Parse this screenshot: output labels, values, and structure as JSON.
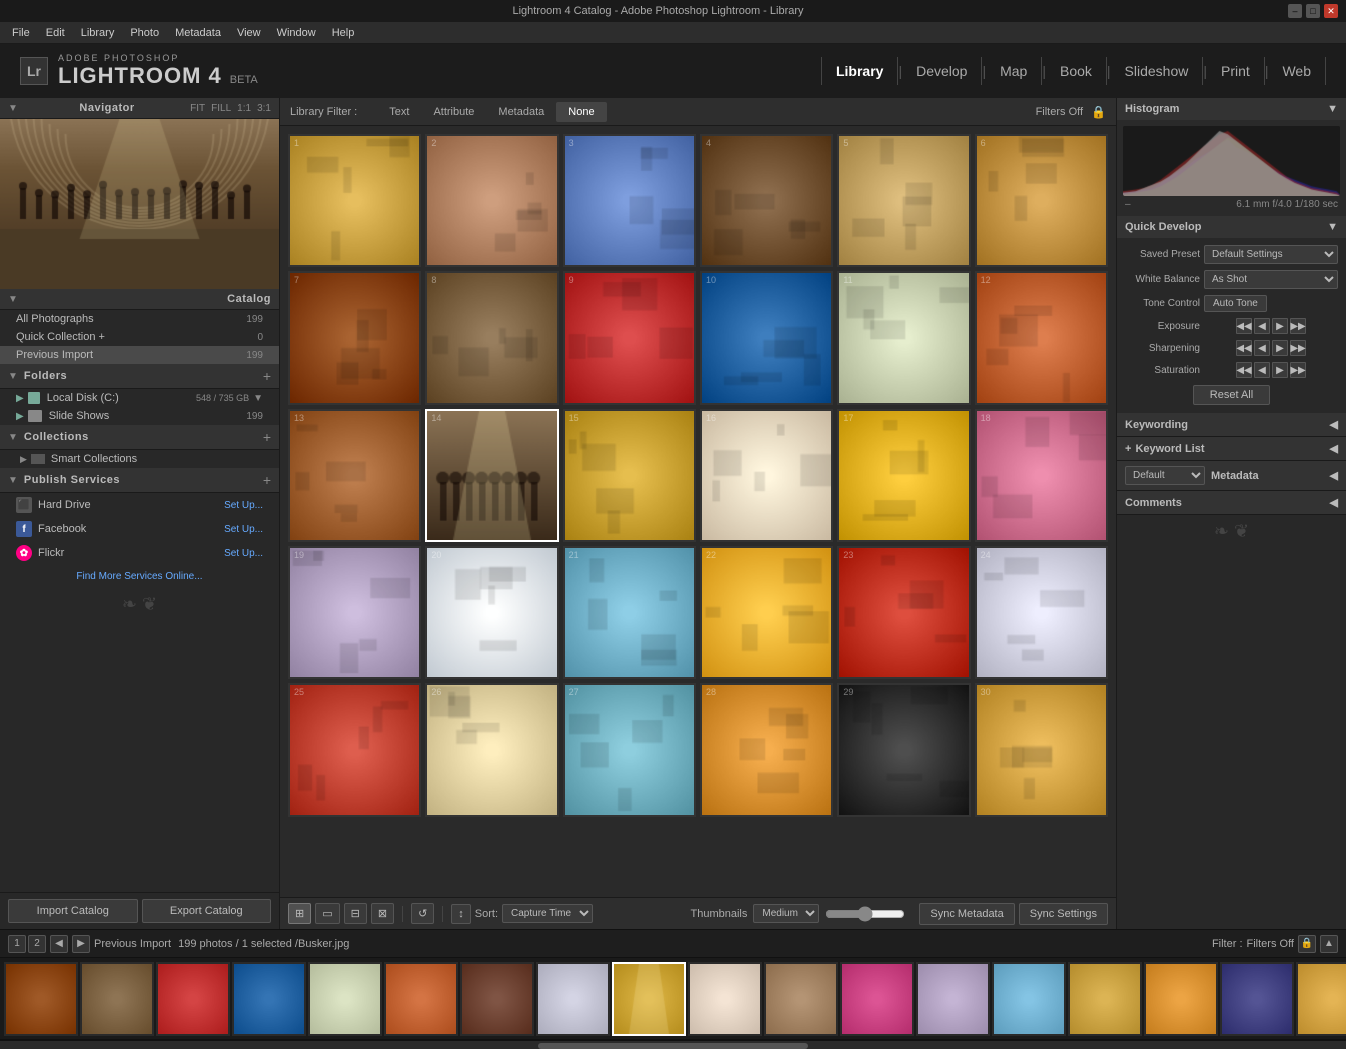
{
  "window": {
    "title": "Lightroom 4 Catalog - Adobe Photoshop Lightroom - Library",
    "controls": [
      "minimize",
      "maximize",
      "close"
    ]
  },
  "menu": {
    "items": [
      "File",
      "Edit",
      "Library",
      "Photo",
      "Metadata",
      "View",
      "Window",
      "Help"
    ]
  },
  "header": {
    "adobe_label": "ADOBE PHOTOSHOP",
    "app_name": "LIGHTROOM 4",
    "beta_label": "BETA",
    "lr_abbr": "Lr",
    "nav_tabs": [
      {
        "label": "Library",
        "active": true
      },
      {
        "label": "Develop",
        "active": false
      },
      {
        "label": "Map",
        "active": false
      },
      {
        "label": "Book",
        "active": false
      },
      {
        "label": "Slideshow",
        "active": false
      },
      {
        "label": "Print",
        "active": false
      },
      {
        "label": "Web",
        "active": false
      }
    ]
  },
  "navigator": {
    "title": "Navigator",
    "zoom_levels": [
      "FIT",
      "FILL",
      "1:1",
      "3:1"
    ]
  },
  "catalog": {
    "title": "Catalog",
    "items": [
      {
        "name": "All Photographs",
        "count": "199"
      },
      {
        "name": "Quick Collection +",
        "count": "0"
      },
      {
        "name": "Previous Import",
        "count": "199",
        "selected": true
      }
    ]
  },
  "folders": {
    "title": "Folders",
    "add_btn": "+",
    "items": [
      {
        "name": "Local Disk (C:)",
        "size": "548 / 735 GB",
        "type": "disk"
      },
      {
        "name": "Slide Shows",
        "count": "199",
        "type": "folder"
      }
    ]
  },
  "collections": {
    "title": "Collections",
    "add_btn": "+",
    "items": [
      {
        "name": "Smart Collections",
        "type": "smart"
      }
    ]
  },
  "publish_services": {
    "title": "Publish Services",
    "add_btn": "+",
    "items": [
      {
        "name": "Hard Drive",
        "type": "harddrive",
        "action": "Set Up..."
      },
      {
        "name": "Facebook",
        "type": "facebook",
        "action": "Set Up..."
      },
      {
        "name": "Flickr",
        "type": "flickr",
        "action": "Set Up..."
      }
    ],
    "find_more": "Find More Services Online..."
  },
  "bottom_buttons": {
    "import": "Import Catalog",
    "export": "Export Catalog"
  },
  "filter_bar": {
    "label": "Library Filter :",
    "tabs": [
      "Text",
      "Attribute",
      "Metadata",
      "None"
    ],
    "active_tab": "None",
    "filters_off": "Filters Off",
    "lock_icon": "🔒"
  },
  "photo_grid": {
    "numbers": [
      1,
      2,
      3,
      4,
      5,
      6,
      7,
      8,
      9,
      10,
      11,
      12,
      13,
      14,
      15,
      16,
      17,
      18,
      19,
      20,
      21,
      22,
      23,
      24,
      25,
      26,
      27,
      28,
      29,
      30
    ],
    "selected": 14,
    "colors": [
      [
        "#8B6914",
        "#c4913a",
        "#5a3020",
        "#6b5428",
        "#8c7040",
        "#c49060"
      ],
      [
        "#5a3020",
        "#8c7040",
        "#c04030",
        "#3060a0",
        "#d0d0c0",
        "#c47030"
      ],
      [
        "#6b4030",
        "#c0c0d0",
        "#4060b0",
        "#c8a030",
        "#e8d8c0",
        "#d07030"
      ],
      [
        "#b0a0c0",
        "#e0d0a0",
        "#70b0c8",
        "#f0b020",
        "#c83020",
        "#d0c0b0"
      ],
      [
        "#a08060",
        "#70a0c0",
        "#c8a040",
        "#d89030",
        "#d0a040",
        "#c89050"
      ]
    ]
  },
  "toolbar": {
    "view_btns": [
      "grid",
      "loupe",
      "compare",
      "survey"
    ],
    "sort_label": "Sort:",
    "sort_option": "Capture Time",
    "thumbnails_label": "Thumbnails",
    "sync_metadata": "Sync Metadata",
    "sync_settings": "Sync Settings"
  },
  "histogram": {
    "title": "Histogram",
    "info": "6.1 mm  f/4.0  1/180 sec"
  },
  "quick_develop": {
    "title": "Quick Develop",
    "saved_preset_label": "Saved Preset",
    "saved_preset_value": "Default Settings",
    "white_balance_label": "White Balance",
    "white_balance_value": "As Shot",
    "tone_control_label": "Tone Control",
    "auto_tone_btn": "Auto Tone",
    "exposure_label": "Exposure",
    "sharpening_label": "Sharpening",
    "saturation_label": "Saturation",
    "reset_btn": "Reset All"
  },
  "right_sections": [
    {
      "title": "Keywording",
      "arrow": "◀"
    },
    {
      "title": "Keyword List",
      "plus": "+",
      "arrow": "◀"
    },
    {
      "title": "Metadata",
      "arrow": "◀"
    },
    {
      "title": "Comments",
      "arrow": "◀"
    }
  ],
  "filmstrip_bar": {
    "pages": [
      "1",
      "2"
    ],
    "prev_icon": "◀",
    "next_icon": "▶",
    "info": "Previous Import",
    "photos_count": "199 photos",
    "selected_info": "/ 1 selected",
    "filename": "/Busker.jpg",
    "filter_label": "Filter :",
    "filters_off": "Filters Off"
  },
  "filmstrip": {
    "count": 18,
    "selected_index": 8,
    "colors": [
      "#8B4513",
      "#7a6040",
      "#c03030",
      "#2060a0",
      "#c8d0b0",
      "#c06030",
      "#6b4030",
      "#c0c0d0",
      "#c8a030",
      "#e0d0c0",
      "#a08060",
      "#c84080",
      "#b0a0c0",
      "#70b0d0",
      "#c8a040",
      "#d89030",
      "#404080",
      "#d0a040"
    ]
  }
}
